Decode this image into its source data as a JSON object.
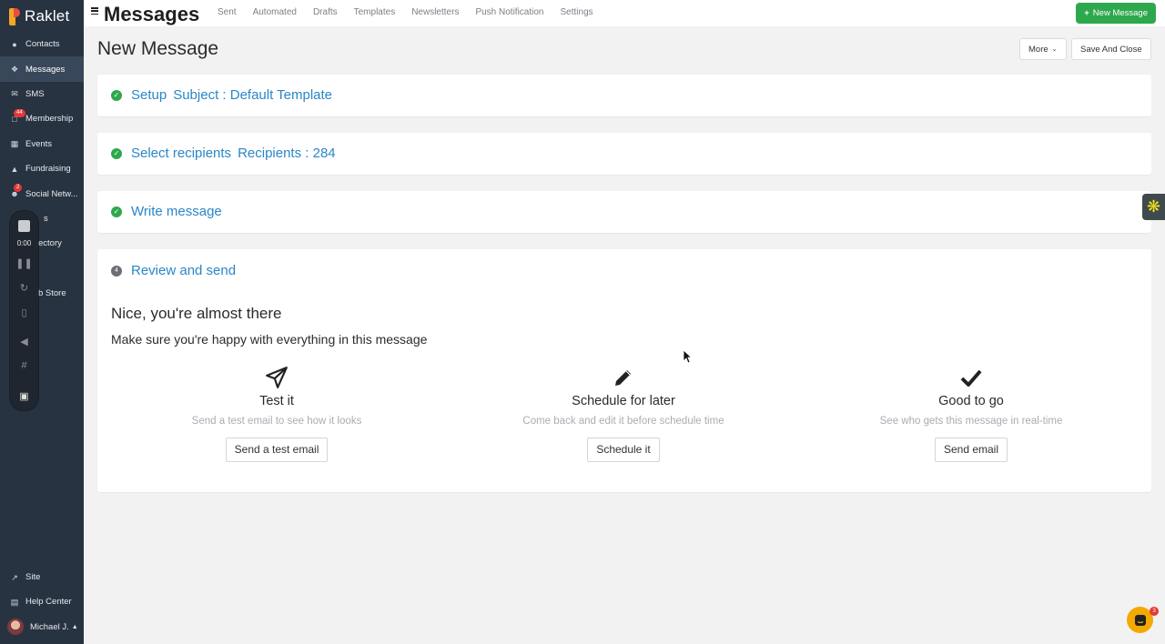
{
  "brand": {
    "name": "Raklet"
  },
  "sidebar": {
    "items": [
      {
        "label": "Contacts",
        "icon": "users-icon"
      },
      {
        "label": "Messages",
        "icon": "messages-icon",
        "active": true
      },
      {
        "label": "SMS",
        "icon": "sms-icon"
      },
      {
        "label": "Membership",
        "icon": "membership-icon",
        "badge": "44"
      },
      {
        "label": "Events",
        "icon": "calendar-icon"
      },
      {
        "label": "Fundraising",
        "icon": "fundraising-icon"
      },
      {
        "label": "Social Netw...",
        "icon": "social-icon",
        "badge": "2"
      },
      {
        "label": "s",
        "icon": "generic-icon"
      },
      {
        "label": "ectory",
        "icon": "directory-icon"
      },
      {
        "label": "",
        "icon": "blank"
      },
      {
        "label": "b Store",
        "icon": "store-icon"
      }
    ],
    "bottom": [
      {
        "label": "Site",
        "icon": "external-link-icon"
      },
      {
        "label": "Help Center",
        "icon": "book-icon"
      },
      {
        "label": "Michael J.",
        "icon": "avatar"
      }
    ]
  },
  "recorder": {
    "time": "0:00"
  },
  "topbar": {
    "title": "Messages",
    "tabs": [
      "Sent",
      "Automated",
      "Drafts",
      "Templates",
      "Newsletters",
      "Push Notification",
      "Settings"
    ],
    "new_button": "New Message"
  },
  "header": {
    "heading": "New Message",
    "more_label": "More",
    "save_close_label": "Save And Close"
  },
  "steps": [
    {
      "title": "Setup",
      "sub": "Subject : Default Template",
      "status": "done"
    },
    {
      "title": "Select recipients",
      "sub": "Recipients : 284",
      "status": "done"
    },
    {
      "title": "Write message",
      "sub": "",
      "status": "done"
    },
    {
      "title": "Review and send",
      "sub": "",
      "status": "current",
      "number": "4"
    }
  ],
  "review": {
    "headline": "Nice, you're almost there",
    "subline": "Make sure you're happy with everything in this message",
    "options": [
      {
        "icon": "paper-plane-icon",
        "title": "Test it",
        "desc": "Send a test email to see how it looks",
        "button": "Send a test email"
      },
      {
        "icon": "pencil-icon",
        "title": "Schedule for later",
        "desc": "Come back and edit it before schedule time",
        "button": "Schedule it"
      },
      {
        "icon": "checkmark-icon",
        "title": "Good to go",
        "desc": "See who gets this message in real-time",
        "button": "Send email"
      }
    ]
  },
  "chat": {
    "badge": "3"
  },
  "colors": {
    "accent": "#2ea84d",
    "link": "#2a86c8",
    "sidebar": "#283341"
  }
}
